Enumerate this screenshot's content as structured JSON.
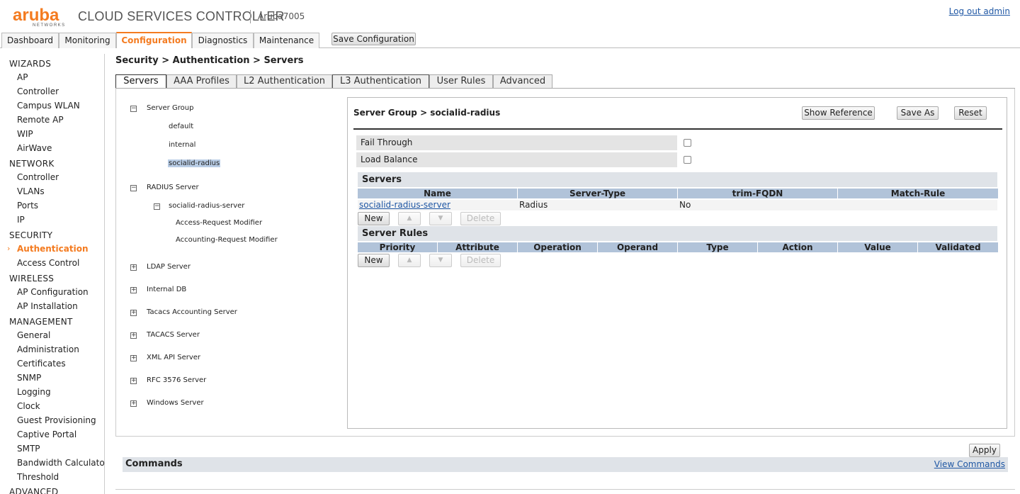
{
  "header": {
    "logo_text": "aruba",
    "logo_sub": "NETWORKS",
    "app_title": "CLOUD SERVICES CONTROLLER",
    "hostname": "Aruba7005",
    "logout": "Log out admin"
  },
  "top_tabs": [
    {
      "label": "Dashboard",
      "active": false
    },
    {
      "label": "Monitoring",
      "active": false
    },
    {
      "label": "Configuration",
      "active": true
    },
    {
      "label": "Diagnostics",
      "active": false
    },
    {
      "label": "Maintenance",
      "active": false
    }
  ],
  "save_configuration": "Save Configuration",
  "sidebar": {
    "wizards": "WIZARDS",
    "wizards_items": [
      "AP",
      "Controller",
      "Campus WLAN",
      "Remote AP",
      "WIP",
      "AirWave"
    ],
    "network": "NETWORK",
    "network_items": [
      "Controller",
      "VLANs",
      "Ports",
      "IP"
    ],
    "security": "SECURITY",
    "security_items": [
      "Authentication",
      "Access Control"
    ],
    "wireless": "WIRELESS",
    "wireless_items": [
      "AP Configuration",
      "AP Installation"
    ],
    "management": "MANAGEMENT",
    "management_items": [
      "General",
      "Administration",
      "Certificates",
      "SNMP",
      "Logging",
      "Clock",
      "Guest Provisioning",
      "Captive Portal",
      "SMTP",
      "Bandwidth Calculator",
      "Threshold"
    ],
    "advanced": "ADVANCED SERVICES",
    "active_item": "Authentication"
  },
  "breadcrumb": "Security > Authentication > Servers",
  "sub_tabs": [
    {
      "label": "Servers",
      "active": true
    },
    {
      "label": "AAA Profiles",
      "active": false
    },
    {
      "label": "L2 Authentication",
      "active": false
    },
    {
      "label": "L3 Authentication",
      "active": false
    },
    {
      "label": "User Rules",
      "active": false
    },
    {
      "label": "Advanced",
      "active": false
    }
  ],
  "tree": {
    "server_group": "Server Group",
    "server_group_children": [
      "default",
      "internal",
      "socialid-radius"
    ],
    "selected": "socialid-radius",
    "radius_server": "RADIUS Server",
    "radius_child": "socialid-radius-server",
    "radius_grandchildren": [
      "Access-Request Modifier",
      "Accounting-Request Modifier"
    ],
    "collapsed": [
      "LDAP Server",
      "Internal DB",
      "Tacacs Accounting Server",
      "TACACS Server",
      "XML API Server",
      "RFC 3576 Server",
      "Windows Server"
    ],
    "expanded_symbol": "−",
    "collapsed_symbol": "+"
  },
  "panel": {
    "title": "Server Group > socialid-radius",
    "show_reference": "Show Reference",
    "save_as": "Save As",
    "reset": "Reset",
    "fail_through": "Fail Through",
    "load_balance": "Load Balance",
    "servers_title": "Servers",
    "servers_columns": [
      "Name",
      "Server-Type",
      "trim-FQDN",
      "Match-Rule"
    ],
    "servers_rows": [
      {
        "name": "socialid-radius-server",
        "type": "Radius",
        "trim": "No",
        "match": ""
      }
    ],
    "rules_title": "Server Rules",
    "rules_columns": [
      "Priority",
      "Attribute",
      "Operation",
      "Operand",
      "Type",
      "Action",
      "Value",
      "Validated"
    ],
    "btn_new": "New",
    "btn_up": "▲",
    "btn_down": "▼",
    "btn_delete": "Delete"
  },
  "commands": {
    "apply": "Apply",
    "title": "Commands",
    "view": "View Commands"
  }
}
